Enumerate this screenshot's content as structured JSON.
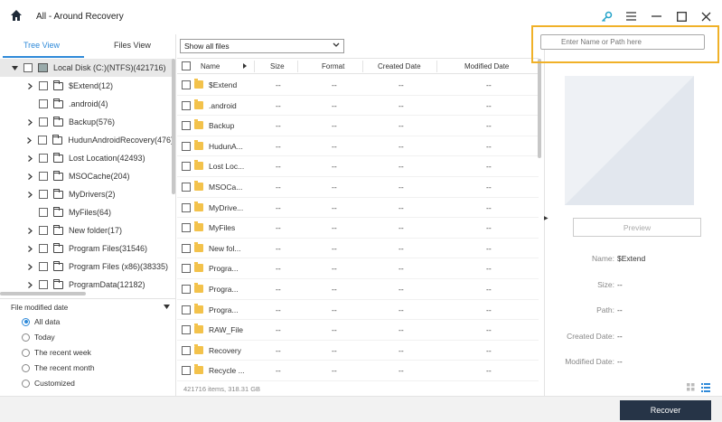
{
  "window": {
    "title": "All - Around Recovery"
  },
  "left_panel": {
    "tabs": [
      {
        "label": "Tree View",
        "active": true
      },
      {
        "label": "Files View",
        "active": false
      }
    ],
    "tree": [
      {
        "label": "Local Disk (C:)(NTFS)(421716)",
        "level": 0,
        "expandable": true,
        "type": "disk"
      },
      {
        "label": "$Extend(12)",
        "level": 1,
        "expandable": true,
        "type": "folder"
      },
      {
        "label": ".android(4)",
        "level": 1,
        "expandable": false,
        "type": "folder"
      },
      {
        "label": "Backup(576)",
        "level": 1,
        "expandable": true,
        "type": "folder"
      },
      {
        "label": "HudunAndroidRecovery(476)",
        "level": 1,
        "expandable": true,
        "type": "folder"
      },
      {
        "label": "Lost Location(42493)",
        "level": 1,
        "expandable": true,
        "type": "folder"
      },
      {
        "label": "MSOCache(204)",
        "level": 1,
        "expandable": true,
        "type": "folder"
      },
      {
        "label": "MyDrivers(2)",
        "level": 1,
        "expandable": true,
        "type": "folder"
      },
      {
        "label": "MyFiles(64)",
        "level": 1,
        "expandable": false,
        "type": "folder"
      },
      {
        "label": "New folder(17)",
        "level": 1,
        "expandable": true,
        "type": "folder"
      },
      {
        "label": "Program Files(31546)",
        "level": 1,
        "expandable": true,
        "type": "folder"
      },
      {
        "label": "Program Files (x86)(38335)",
        "level": 1,
        "expandable": true,
        "type": "folder"
      },
      {
        "label": "ProgramData(12182)",
        "level": 1,
        "expandable": true,
        "type": "folder"
      }
    ],
    "filter": {
      "title": "File modified date",
      "options": [
        "All data",
        "Today",
        "The recent week",
        "The recent month",
        "Customized"
      ],
      "selected": "All data"
    }
  },
  "middle": {
    "show_select": "Show all files",
    "columns": [
      "Name",
      "Size",
      "Format",
      "Created Date",
      "Modified Date"
    ],
    "rows": [
      {
        "name": "$Extend",
        "size": "--",
        "format": "--",
        "created": "--",
        "modified": "--"
      },
      {
        "name": ".android",
        "size": "--",
        "format": "--",
        "created": "--",
        "modified": "--"
      },
      {
        "name": "Backup",
        "size": "--",
        "format": "--",
        "created": "--",
        "modified": "--"
      },
      {
        "name": "HudunA...",
        "size": "--",
        "format": "--",
        "created": "--",
        "modified": "--"
      },
      {
        "name": "Lost Loc...",
        "size": "--",
        "format": "--",
        "created": "--",
        "modified": "--"
      },
      {
        "name": "MSOCa...",
        "size": "--",
        "format": "--",
        "created": "--",
        "modified": "--"
      },
      {
        "name": "MyDrive...",
        "size": "--",
        "format": "--",
        "created": "--",
        "modified": "--"
      },
      {
        "name": "MyFiles",
        "size": "--",
        "format": "--",
        "created": "--",
        "modified": "--"
      },
      {
        "name": "New fol...",
        "size": "--",
        "format": "--",
        "created": "--",
        "modified": "--"
      },
      {
        "name": "Progra...",
        "size": "--",
        "format": "--",
        "created": "--",
        "modified": "--"
      },
      {
        "name": "Progra...",
        "size": "--",
        "format": "--",
        "created": "--",
        "modified": "--"
      },
      {
        "name": "Progra...",
        "size": "--",
        "format": "--",
        "created": "--",
        "modified": "--"
      },
      {
        "name": "RAW_File",
        "size": "--",
        "format": "--",
        "created": "--",
        "modified": "--"
      },
      {
        "name": "Recovery",
        "size": "--",
        "format": "--",
        "created": "--",
        "modified": "--"
      },
      {
        "name": "Recycle ...",
        "size": "--",
        "format": "--",
        "created": "--",
        "modified": "--"
      }
    ],
    "footer": "421716 items, 318.31 GB"
  },
  "right_panel": {
    "search_placeholder": "Enter Name or Path here",
    "preview_label": "Preview",
    "info": [
      {
        "label": "Name:",
        "value": "$Extend"
      },
      {
        "label": "Size:",
        "value": "--"
      },
      {
        "label": "Path:",
        "value": "--"
      },
      {
        "label": "Created Date:",
        "value": "--"
      },
      {
        "label": "Modified Date:",
        "value": "--"
      }
    ]
  },
  "bottom": {
    "recover_label": "Recover"
  },
  "colors": {
    "accent": "#2f8ad9",
    "highlight": "#f0b128",
    "recover_bg": "#263447"
  }
}
